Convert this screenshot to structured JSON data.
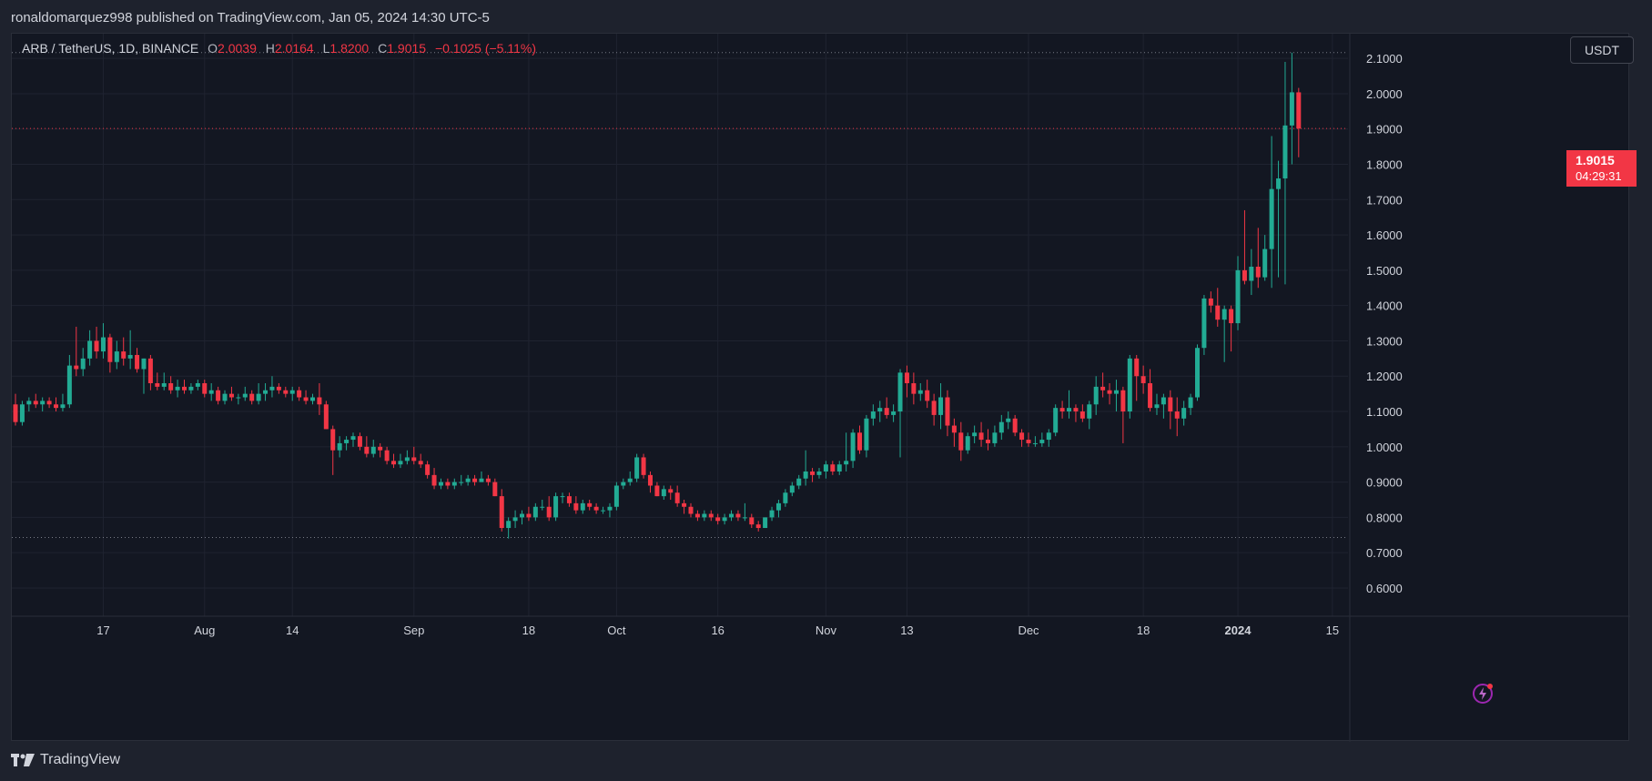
{
  "header": {
    "published_by": "ronaldomarquez998 published on TradingView.com, Jan 05, 2024 14:30 UTC-5"
  },
  "legend": {
    "symbol": "ARB / TetherUS, 1D, BINANCE",
    "open_label": "O",
    "open": "2.0039",
    "high_label": "H",
    "high": "2.0164",
    "low_label": "L",
    "low": "1.8200",
    "close_label": "C",
    "close": "1.9015",
    "change": "−0.1025 (−5.11%)"
  },
  "currency_button": {
    "label": "USDT"
  },
  "last_price": {
    "price": "1.9015",
    "countdown": "04:29:31"
  },
  "footer": {
    "brand": "TradingView"
  },
  "colors": {
    "up": "#22ab94",
    "down": "#f23645",
    "grid": "#1f2330",
    "axis_text": "#d1d4dc",
    "background": "#131722"
  },
  "chart_data": {
    "type": "candlestick",
    "interval": "1D",
    "ylim": [
      0.52,
      2.17
    ],
    "y_ticks": [
      "2.1000",
      "2.0000",
      "1.9000",
      "1.8000",
      "1.7000",
      "1.6000",
      "1.5000",
      "1.4000",
      "1.3000",
      "1.2000",
      "1.1000",
      "1.0000",
      "0.9000",
      "0.8000",
      "0.7000",
      "0.6000"
    ],
    "x_ticks": [
      {
        "label": "17",
        "index": 13
      },
      {
        "label": "Aug",
        "index": 28
      },
      {
        "label": "14",
        "index": 41
      },
      {
        "label": "Sep",
        "index": 59
      },
      {
        "label": "18",
        "index": 76
      },
      {
        "label": "Oct",
        "index": 89
      },
      {
        "label": "16",
        "index": 104
      },
      {
        "label": "Nov",
        "index": 120
      },
      {
        "label": "13",
        "index": 132
      },
      {
        "label": "Dec",
        "index": 150
      },
      {
        "label": "18",
        "index": 167
      },
      {
        "label": "2024",
        "index": 181
      },
      {
        "label": "15",
        "index": 195
      }
    ],
    "reference_lines": [
      2.1164,
      1.9015,
      0.743
    ],
    "candles": [
      [
        1.12,
        1.15,
        1.06,
        1.07
      ],
      [
        1.07,
        1.13,
        1.06,
        1.12
      ],
      [
        1.12,
        1.14,
        1.1,
        1.13
      ],
      [
        1.13,
        1.15,
        1.11,
        1.12
      ],
      [
        1.12,
        1.14,
        1.1,
        1.13
      ],
      [
        1.13,
        1.14,
        1.11,
        1.12
      ],
      [
        1.12,
        1.14,
        1.1,
        1.11
      ],
      [
        1.11,
        1.15,
        1.1,
        1.12
      ],
      [
        1.12,
        1.26,
        1.11,
        1.23
      ],
      [
        1.23,
        1.34,
        1.2,
        1.22
      ],
      [
        1.22,
        1.28,
        1.2,
        1.25
      ],
      [
        1.25,
        1.33,
        1.23,
        1.3
      ],
      [
        1.3,
        1.34,
        1.25,
        1.27
      ],
      [
        1.27,
        1.35,
        1.25,
        1.31
      ],
      [
        1.31,
        1.32,
        1.21,
        1.24
      ],
      [
        1.24,
        1.3,
        1.22,
        1.27
      ],
      [
        1.27,
        1.31,
        1.23,
        1.25
      ],
      [
        1.25,
        1.33,
        1.22,
        1.26
      ],
      [
        1.26,
        1.28,
        1.21,
        1.22
      ],
      [
        1.22,
        1.25,
        1.15,
        1.25
      ],
      [
        1.25,
        1.26,
        1.16,
        1.18
      ],
      [
        1.18,
        1.21,
        1.16,
        1.17
      ],
      [
        1.17,
        1.21,
        1.16,
        1.18
      ],
      [
        1.18,
        1.2,
        1.15,
        1.16
      ],
      [
        1.16,
        1.19,
        1.14,
        1.17
      ],
      [
        1.17,
        1.19,
        1.15,
        1.16
      ],
      [
        1.16,
        1.18,
        1.15,
        1.17
      ],
      [
        1.17,
        1.19,
        1.16,
        1.18
      ],
      [
        1.18,
        1.19,
        1.14,
        1.15
      ],
      [
        1.15,
        1.18,
        1.13,
        1.16
      ],
      [
        1.16,
        1.17,
        1.12,
        1.13
      ],
      [
        1.13,
        1.16,
        1.12,
        1.15
      ],
      [
        1.15,
        1.17,
        1.13,
        1.14
      ],
      [
        1.14,
        1.15,
        1.12,
        1.14
      ],
      [
        1.14,
        1.17,
        1.13,
        1.15
      ],
      [
        1.15,
        1.16,
        1.12,
        1.13
      ],
      [
        1.13,
        1.18,
        1.12,
        1.15
      ],
      [
        1.15,
        1.18,
        1.13,
        1.16
      ],
      [
        1.16,
        1.2,
        1.14,
        1.17
      ],
      [
        1.17,
        1.18,
        1.15,
        1.16
      ],
      [
        1.16,
        1.17,
        1.14,
        1.15
      ],
      [
        1.15,
        1.17,
        1.13,
        1.16
      ],
      [
        1.16,
        1.17,
        1.13,
        1.14
      ],
      [
        1.14,
        1.16,
        1.12,
        1.13
      ],
      [
        1.13,
        1.15,
        1.12,
        1.14
      ],
      [
        1.14,
        1.18,
        1.09,
        1.12
      ],
      [
        1.12,
        1.13,
        1.05,
        1.05
      ],
      [
        1.05,
        1.06,
        0.92,
        0.99
      ],
      [
        0.99,
        1.03,
        0.97,
        1.01
      ],
      [
        1.01,
        1.03,
        0.99,
        1.02
      ],
      [
        1.02,
        1.04,
        1.0,
        1.03
      ],
      [
        1.03,
        1.04,
        0.99,
        1.0
      ],
      [
        1.0,
        1.03,
        0.97,
        0.98
      ],
      [
        0.98,
        1.02,
        0.97,
        1.0
      ],
      [
        1.0,
        1.01,
        0.97,
        0.99
      ],
      [
        0.99,
        1.0,
        0.95,
        0.96
      ],
      [
        0.96,
        0.98,
        0.94,
        0.95
      ],
      [
        0.95,
        0.98,
        0.94,
        0.96
      ],
      [
        0.96,
        0.99,
        0.95,
        0.97
      ],
      [
        0.97,
        1.0,
        0.95,
        0.96
      ],
      [
        0.96,
        0.98,
        0.94,
        0.95
      ],
      [
        0.95,
        0.96,
        0.91,
        0.92
      ],
      [
        0.92,
        0.94,
        0.88,
        0.89
      ],
      [
        0.89,
        0.91,
        0.88,
        0.9
      ],
      [
        0.9,
        0.91,
        0.88,
        0.89
      ],
      [
        0.89,
        0.91,
        0.88,
        0.9
      ],
      [
        0.9,
        0.92,
        0.89,
        0.9
      ],
      [
        0.9,
        0.92,
        0.89,
        0.91
      ],
      [
        0.91,
        0.92,
        0.89,
        0.9
      ],
      [
        0.9,
        0.93,
        0.9,
        0.91
      ],
      [
        0.91,
        0.92,
        0.89,
        0.9
      ],
      [
        0.9,
        0.91,
        0.86,
        0.86
      ],
      [
        0.86,
        0.88,
        0.76,
        0.77
      ],
      [
        0.77,
        0.8,
        0.74,
        0.79
      ],
      [
        0.79,
        0.82,
        0.77,
        0.8
      ],
      [
        0.8,
        0.82,
        0.78,
        0.81
      ],
      [
        0.81,
        0.83,
        0.79,
        0.8
      ],
      [
        0.8,
        0.84,
        0.79,
        0.83
      ],
      [
        0.83,
        0.85,
        0.82,
        0.83
      ],
      [
        0.83,
        0.86,
        0.79,
        0.8
      ],
      [
        0.8,
        0.87,
        0.79,
        0.86
      ],
      [
        0.86,
        0.87,
        0.84,
        0.86
      ],
      [
        0.86,
        0.87,
        0.83,
        0.84
      ],
      [
        0.84,
        0.86,
        0.81,
        0.82
      ],
      [
        0.82,
        0.85,
        0.81,
        0.84
      ],
      [
        0.84,
        0.85,
        0.82,
        0.83
      ],
      [
        0.83,
        0.84,
        0.81,
        0.82
      ],
      [
        0.82,
        0.83,
        0.81,
        0.82
      ],
      [
        0.82,
        0.84,
        0.8,
        0.83
      ],
      [
        0.83,
        0.9,
        0.82,
        0.89
      ],
      [
        0.89,
        0.91,
        0.88,
        0.9
      ],
      [
        0.9,
        0.93,
        0.89,
        0.91
      ],
      [
        0.91,
        0.98,
        0.9,
        0.97
      ],
      [
        0.97,
        0.98,
        0.91,
        0.92
      ],
      [
        0.92,
        0.93,
        0.87,
        0.89
      ],
      [
        0.89,
        0.9,
        0.86,
        0.86
      ],
      [
        0.86,
        0.89,
        0.85,
        0.88
      ],
      [
        0.88,
        0.89,
        0.85,
        0.87
      ],
      [
        0.87,
        0.89,
        0.83,
        0.84
      ],
      [
        0.84,
        0.85,
        0.81,
        0.83
      ],
      [
        0.83,
        0.84,
        0.8,
        0.81
      ],
      [
        0.81,
        0.82,
        0.79,
        0.8
      ],
      [
        0.8,
        0.82,
        0.79,
        0.81
      ],
      [
        0.81,
        0.82,
        0.79,
        0.8
      ],
      [
        0.8,
        0.81,
        0.78,
        0.79
      ],
      [
        0.79,
        0.81,
        0.78,
        0.8
      ],
      [
        0.8,
        0.82,
        0.79,
        0.81
      ],
      [
        0.81,
        0.82,
        0.79,
        0.8
      ],
      [
        0.8,
        0.84,
        0.79,
        0.8
      ],
      [
        0.8,
        0.81,
        0.77,
        0.78
      ],
      [
        0.78,
        0.79,
        0.76,
        0.77
      ],
      [
        0.77,
        0.8,
        0.77,
        0.8
      ],
      [
        0.8,
        0.83,
        0.79,
        0.82
      ],
      [
        0.82,
        0.85,
        0.8,
        0.84
      ],
      [
        0.84,
        0.88,
        0.83,
        0.87
      ],
      [
        0.87,
        0.9,
        0.86,
        0.89
      ],
      [
        0.89,
        0.92,
        0.88,
        0.91
      ],
      [
        0.91,
        0.99,
        0.89,
        0.93
      ],
      [
        0.93,
        0.94,
        0.9,
        0.92
      ],
      [
        0.92,
        0.94,
        0.91,
        0.93
      ],
      [
        0.93,
        0.96,
        0.91,
        0.95
      ],
      [
        0.95,
        0.96,
        0.92,
        0.93
      ],
      [
        0.93,
        0.96,
        0.92,
        0.95
      ],
      [
        0.95,
        1.04,
        0.93,
        0.96
      ],
      [
        0.96,
        1.05,
        0.94,
        1.04
      ],
      [
        1.04,
        1.06,
        0.98,
        0.99
      ],
      [
        0.99,
        1.09,
        0.97,
        1.08
      ],
      [
        1.08,
        1.12,
        1.06,
        1.1
      ],
      [
        1.1,
        1.13,
        1.07,
        1.11
      ],
      [
        1.11,
        1.14,
        1.08,
        1.09
      ],
      [
        1.09,
        1.12,
        1.07,
        1.1
      ],
      [
        1.1,
        1.22,
        0.97,
        1.21
      ],
      [
        1.21,
        1.23,
        1.14,
        1.18
      ],
      [
        1.18,
        1.21,
        1.12,
        1.15
      ],
      [
        1.15,
        1.18,
        1.13,
        1.16
      ],
      [
        1.16,
        1.19,
        1.11,
        1.13
      ],
      [
        1.13,
        1.15,
        1.06,
        1.09
      ],
      [
        1.09,
        1.18,
        1.05,
        1.14
      ],
      [
        1.14,
        1.16,
        1.03,
        1.06
      ],
      [
        1.06,
        1.08,
        1.0,
        1.04
      ],
      [
        1.04,
        1.07,
        0.96,
        0.99
      ],
      [
        0.99,
        1.04,
        0.98,
        1.03
      ],
      [
        1.03,
        1.06,
        1.01,
        1.04
      ],
      [
        1.04,
        1.07,
        1.0,
        1.02
      ],
      [
        1.02,
        1.05,
        0.99,
        1.01
      ],
      [
        1.01,
        1.06,
        1.0,
        1.04
      ],
      [
        1.04,
        1.09,
        1.02,
        1.07
      ],
      [
        1.07,
        1.1,
        1.05,
        1.08
      ],
      [
        1.08,
        1.09,
        1.03,
        1.04
      ],
      [
        1.04,
        1.05,
        1.0,
        1.02
      ],
      [
        1.02,
        1.04,
        1.0,
        1.01
      ],
      [
        1.01,
        1.03,
        1.0,
        1.01
      ],
      [
        1.01,
        1.04,
        1.0,
        1.02
      ],
      [
        1.02,
        1.05,
        1.0,
        1.04
      ],
      [
        1.04,
        1.12,
        1.03,
        1.11
      ],
      [
        1.11,
        1.13,
        1.08,
        1.1
      ],
      [
        1.1,
        1.16,
        1.08,
        1.11
      ],
      [
        1.11,
        1.12,
        1.07,
        1.1
      ],
      [
        1.1,
        1.12,
        1.07,
        1.08
      ],
      [
        1.08,
        1.13,
        1.05,
        1.12
      ],
      [
        1.12,
        1.2,
        1.09,
        1.17
      ],
      [
        1.17,
        1.21,
        1.14,
        1.16
      ],
      [
        1.16,
        1.18,
        1.12,
        1.15
      ],
      [
        1.15,
        1.19,
        1.1,
        1.16
      ],
      [
        1.16,
        1.17,
        1.01,
        1.1
      ],
      [
        1.1,
        1.26,
        1.08,
        1.25
      ],
      [
        1.25,
        1.26,
        1.13,
        1.2
      ],
      [
        1.2,
        1.23,
        1.15,
        1.18
      ],
      [
        1.18,
        1.22,
        1.1,
        1.11
      ],
      [
        1.11,
        1.15,
        1.09,
        1.12
      ],
      [
        1.12,
        1.15,
        1.08,
        1.14
      ],
      [
        1.14,
        1.16,
        1.05,
        1.1
      ],
      [
        1.1,
        1.14,
        1.03,
        1.08
      ],
      [
        1.08,
        1.13,
        1.06,
        1.11
      ],
      [
        1.11,
        1.15,
        1.09,
        1.14
      ],
      [
        1.14,
        1.29,
        1.13,
        1.28
      ],
      [
        1.28,
        1.43,
        1.26,
        1.42
      ],
      [
        1.42,
        1.44,
        1.38,
        1.4
      ],
      [
        1.4,
        1.45,
        1.34,
        1.36
      ],
      [
        1.36,
        1.4,
        1.24,
        1.39
      ],
      [
        1.39,
        1.4,
        1.27,
        1.35
      ],
      [
        1.35,
        1.54,
        1.33,
        1.5
      ],
      [
        1.5,
        1.67,
        1.46,
        1.47
      ],
      [
        1.47,
        1.56,
        1.43,
        1.51
      ],
      [
        1.51,
        1.62,
        1.45,
        1.48
      ],
      [
        1.48,
        1.6,
        1.47,
        1.56
      ],
      [
        1.56,
        1.88,
        1.45,
        1.73
      ],
      [
        1.73,
        1.81,
        1.48,
        1.76
      ],
      [
        1.76,
        2.09,
        1.46,
        1.91
      ],
      [
        1.91,
        2.1164,
        1.8,
        2.0039
      ],
      [
        2.0039,
        2.0164,
        1.82,
        1.9015
      ]
    ]
  }
}
